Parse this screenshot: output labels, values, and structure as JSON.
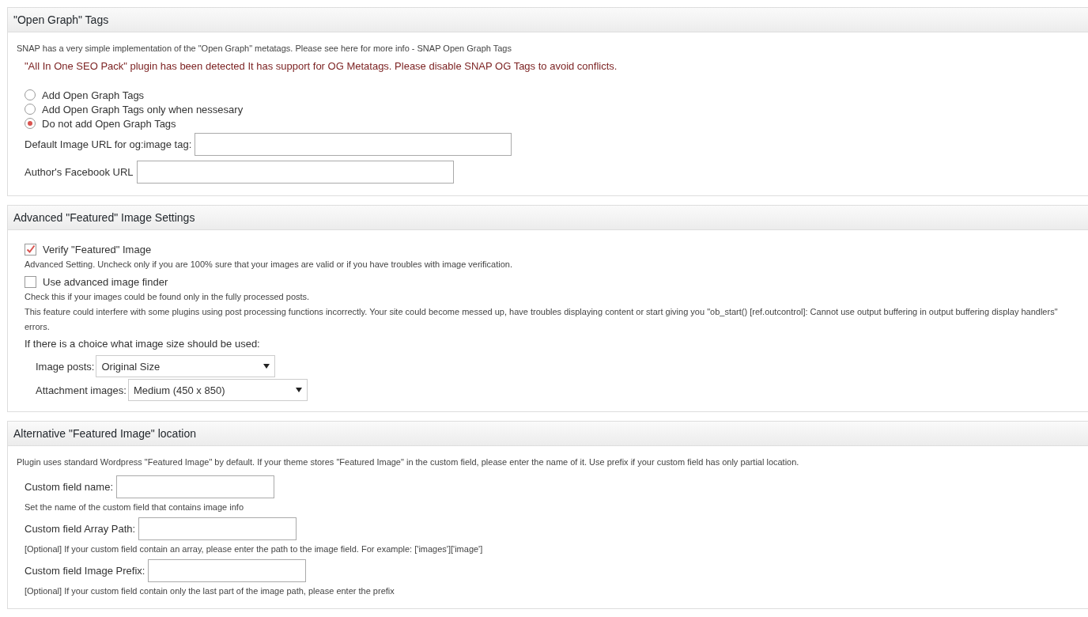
{
  "sections": [
    {
      "title": "\"Open Graph\" Tags",
      "items": [
        {
          "kind": "note",
          "text": "SNAP has a very simple implementation of the \"Open Graph\" metatags. Please see here for more info - SNAP Open Graph Tags"
        },
        {
          "kind": "warning",
          "text": "\"All In One SEO Pack\" plugin has been detected It has support for OG Metatags. Please disable SNAP OG Tags to avoid conflicts."
        },
        {
          "kind": "radio",
          "label": "Add Open Graph Tags",
          "selected": false
        },
        {
          "kind": "radio",
          "label": "Add Open Graph Tags only when nessesary",
          "selected": false
        },
        {
          "kind": "radio",
          "label": "Do not add Open Graph Tags",
          "selected": true
        },
        {
          "kind": "url",
          "label": "Default Image URL for og:image tag:"
        },
        {
          "kind": "url",
          "label": "Author's Facebook URL"
        }
      ]
    },
    {
      "title": "Advanced \"Featured\" Image Settings",
      "items": [
        {
          "kind": "checkbox",
          "label": "Verify \"Featured\" Image",
          "checked": true
        },
        {
          "kind": "hint",
          "text": "Advanced Setting. Uncheck only if you are 100% sure that your images are valid or if you have troubles with image verification."
        },
        {
          "kind": "checkbox",
          "label": "Use advanced image finder",
          "checked": false
        },
        {
          "kind": "hint",
          "text": "Check this if your images could be found only in the fully processed posts."
        },
        {
          "kind": "hint",
          "text": "This feature could interfere with some plugins using post processing functions incorrectly. Your site could become messed up, have troubles displaying content or start giving you \"ob_start() [ref.outcontrol]: Cannot use output buffering in output buffering display handlers\" errors."
        },
        {
          "kind": "heading",
          "text": "If there is a choice what image size should be used:"
        },
        {
          "kind": "select",
          "label": "Image posts:",
          "value": "Original Size"
        },
        {
          "kind": "select",
          "label": "Attachment images:",
          "value": "Medium (450 x 850)"
        }
      ]
    },
    {
      "title": "Alternative \"Featured Image\" location",
      "items": [
        {
          "kind": "note",
          "text": "Plugin uses standard Wordpress \"Featured Image\" by default. If your theme stores \"Featured Image\" in the custom field, please enter the name of it. Use prefix if your custom field has only partial location."
        },
        {
          "kind": "field",
          "label": "Custom field name:"
        },
        {
          "kind": "hint",
          "text": "Set the name of the custom field that contains image info"
        },
        {
          "kind": "field",
          "label": "Custom field Array Path:"
        },
        {
          "kind": "hint",
          "text": "[Optional] If your custom field contain an array, please enter the path to the image field. For example: ['images']['image']"
        },
        {
          "kind": "field",
          "label": "Custom field Image Prefix:"
        },
        {
          "kind": "hint",
          "text": "[Optional] If your custom field contain only the last part of the image path, please enter the prefix"
        }
      ]
    }
  ]
}
